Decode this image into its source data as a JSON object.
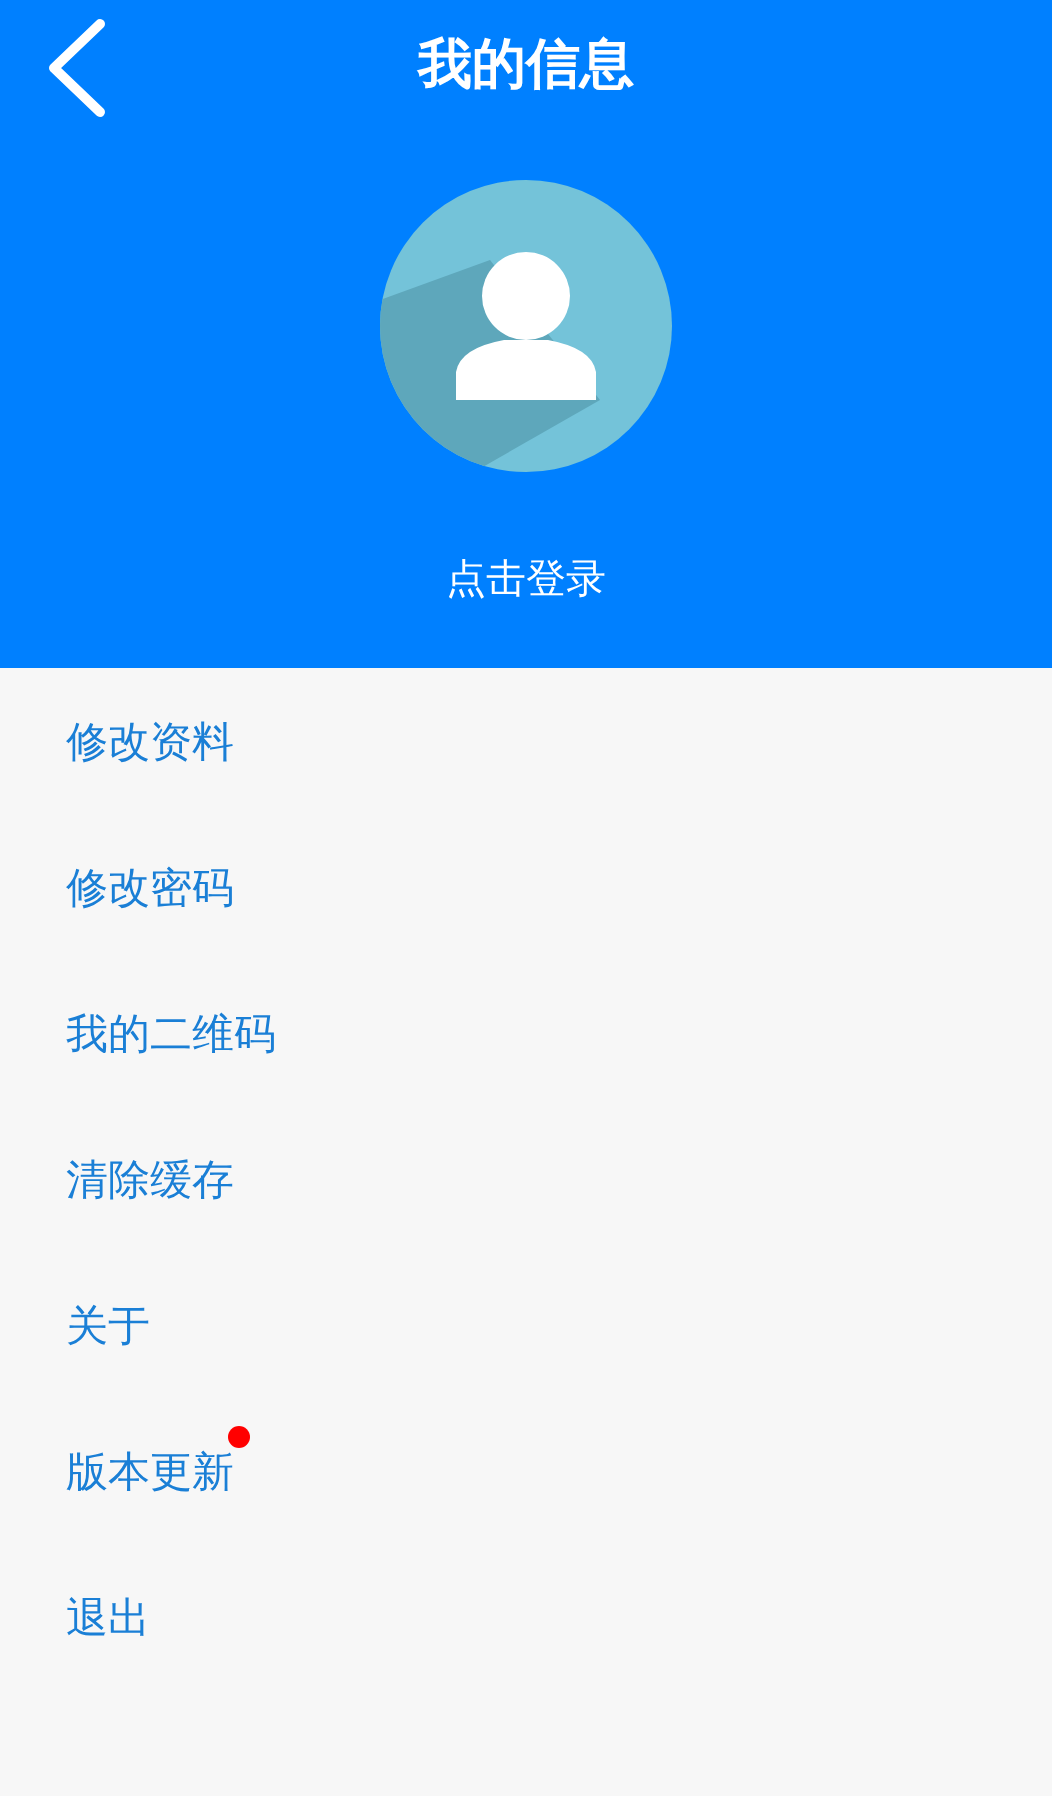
{
  "header": {
    "title": "我的信息",
    "login_label": "点击登录"
  },
  "menu": [
    {
      "label": "修改资料",
      "dot": false
    },
    {
      "label": "修改密码",
      "dot": false
    },
    {
      "label": "我的二维码",
      "dot": false
    },
    {
      "label": "清除缓存",
      "dot": false
    },
    {
      "label": "关于",
      "dot": false
    },
    {
      "label": "版本更新",
      "dot": true
    },
    {
      "label": "退出",
      "dot": false
    }
  ]
}
